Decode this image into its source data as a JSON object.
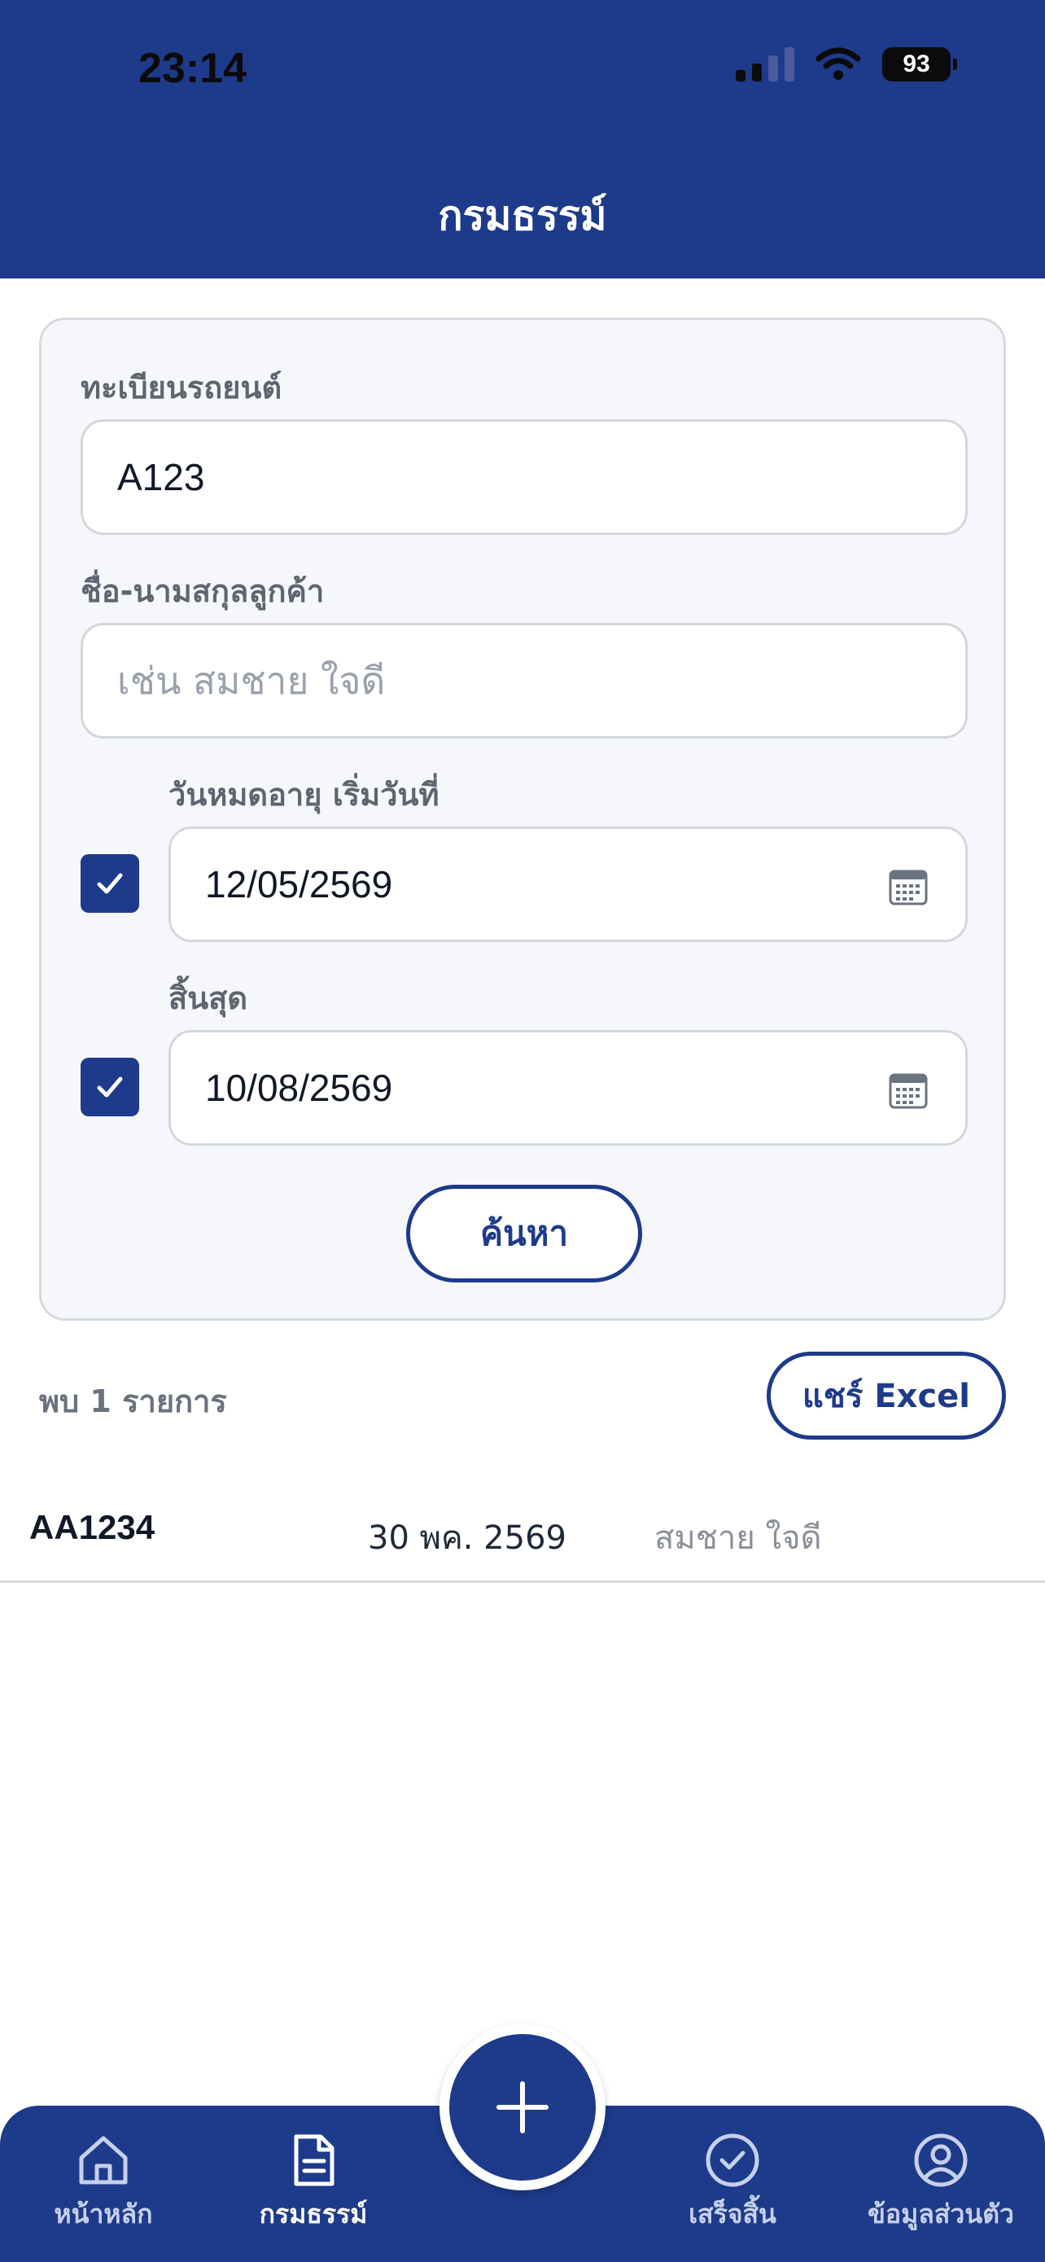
{
  "status_bar": {
    "time": "23:14",
    "battery": "93"
  },
  "header": {
    "title": "กรมธรรม์"
  },
  "filters": {
    "plate_label": "ทะเบียนรถยนต์",
    "plate_value": "A123",
    "name_label": "ชื่อ-นามสกุลลูกค้า",
    "name_placeholder": "เช่น สมชาย ใจดี",
    "start_label": "วันหมดอายุ เริ่มวันที่",
    "start_value": "12/05/2569",
    "start_checked": true,
    "end_label": "สิ้นสุด",
    "end_value": "10/08/2569",
    "end_checked": true,
    "search_label": "ค้นหา"
  },
  "results": {
    "count_text": "พบ 1 รายการ",
    "share_label": "แชร์ Excel",
    "rows": [
      {
        "plate": "AA1234",
        "date": "30 พค. 2569",
        "name": "สมชาย ใจดี"
      }
    ]
  },
  "nav": {
    "items": [
      {
        "label": "หน้าหลัก",
        "icon": "home-icon",
        "active": false
      },
      {
        "label": "กรมธรรม์",
        "icon": "document-icon",
        "active": true
      },
      {
        "label": "เสร็จสิ้น",
        "icon": "check-circle-icon",
        "active": false
      },
      {
        "label": "ข้อมูลส่วนตัว",
        "icon": "user-circle-icon",
        "active": false
      }
    ],
    "fab_icon": "plus-icon"
  },
  "colors": {
    "primary": "#1e3a8a",
    "card_bg": "#f5f7fa",
    "border": "#d3d7dd"
  }
}
